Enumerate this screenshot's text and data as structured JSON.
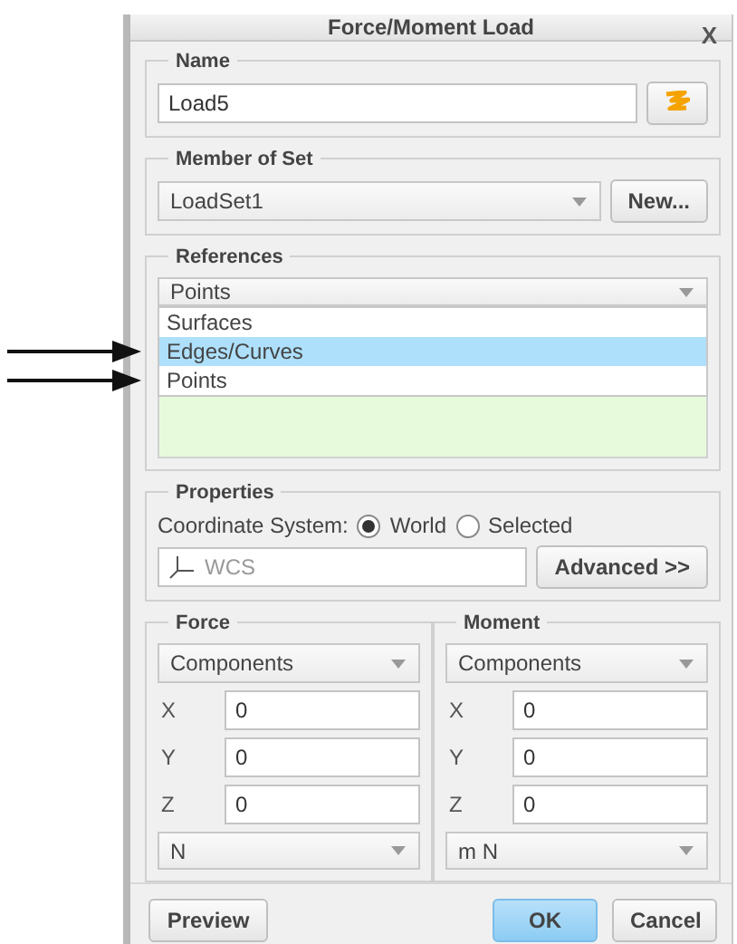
{
  "window": {
    "title": "Force/Moment Load",
    "close": "X"
  },
  "name": {
    "legend": "Name",
    "value": "Load5"
  },
  "member_of_set": {
    "legend": "Member of Set",
    "value": "LoadSet1",
    "button": "New..."
  },
  "references": {
    "legend": "References",
    "value": "Points",
    "expanded": true,
    "options": [
      {
        "label": "Surfaces",
        "highlighted": false,
        "pointed": false
      },
      {
        "label": "Edges/Curves",
        "highlighted": true,
        "pointed": true
      },
      {
        "label": "Points",
        "highlighted": false,
        "pointed": true
      }
    ]
  },
  "properties": {
    "legend": "Properties",
    "label": "Coordinate System:",
    "options": [
      {
        "label": "World",
        "selected": true
      },
      {
        "label": "Selected",
        "selected": false
      }
    ],
    "csys": "WCS",
    "button": "Advanced >>"
  },
  "loads": [
    {
      "legend": "Force",
      "mode": "Components",
      "components": [
        {
          "axis": "X",
          "value": "0"
        },
        {
          "axis": "Y",
          "value": "0"
        },
        {
          "axis": "Z",
          "value": "0"
        }
      ],
      "unit": "N"
    },
    {
      "legend": "Moment",
      "mode": "Components",
      "components": [
        {
          "axis": "X",
          "value": "0"
        },
        {
          "axis": "Y",
          "value": "0"
        },
        {
          "axis": "Z",
          "value": "0"
        }
      ],
      "unit": "m N"
    }
  ],
  "buttons": [
    {
      "label": "Preview",
      "kind": "default"
    },
    {
      "label": "OK",
      "kind": "primary"
    },
    {
      "label": "Cancel",
      "kind": "default"
    }
  ]
}
